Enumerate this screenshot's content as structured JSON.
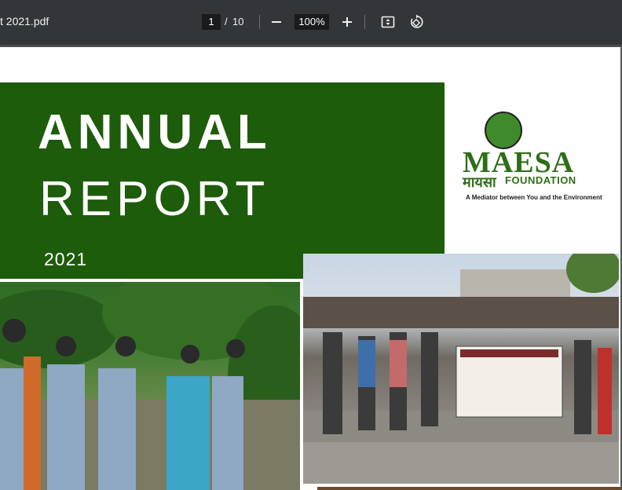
{
  "toolbar": {
    "title": "t 2021.pdf",
    "current_page": "1",
    "page_separator": "/",
    "total_pages": "10",
    "zoom": "100%"
  },
  "document": {
    "heading_line1": "ANNUAL",
    "heading_line2": "REPORT",
    "year": "2021",
    "logo": {
      "name": "MAESA",
      "name_devanagari": "मायसा",
      "foundation": "FOUNDATION",
      "tagline": "A Mediator between You and the Environment"
    }
  },
  "colors": {
    "toolbar_bg": "#323639",
    "viewer_bg": "#525659",
    "report_green": "#1d5c0a",
    "logo_green": "#2d6e16"
  },
  "icons": [
    "minus-icon",
    "plus-icon",
    "fit-page-icon",
    "rotate-icon"
  ]
}
